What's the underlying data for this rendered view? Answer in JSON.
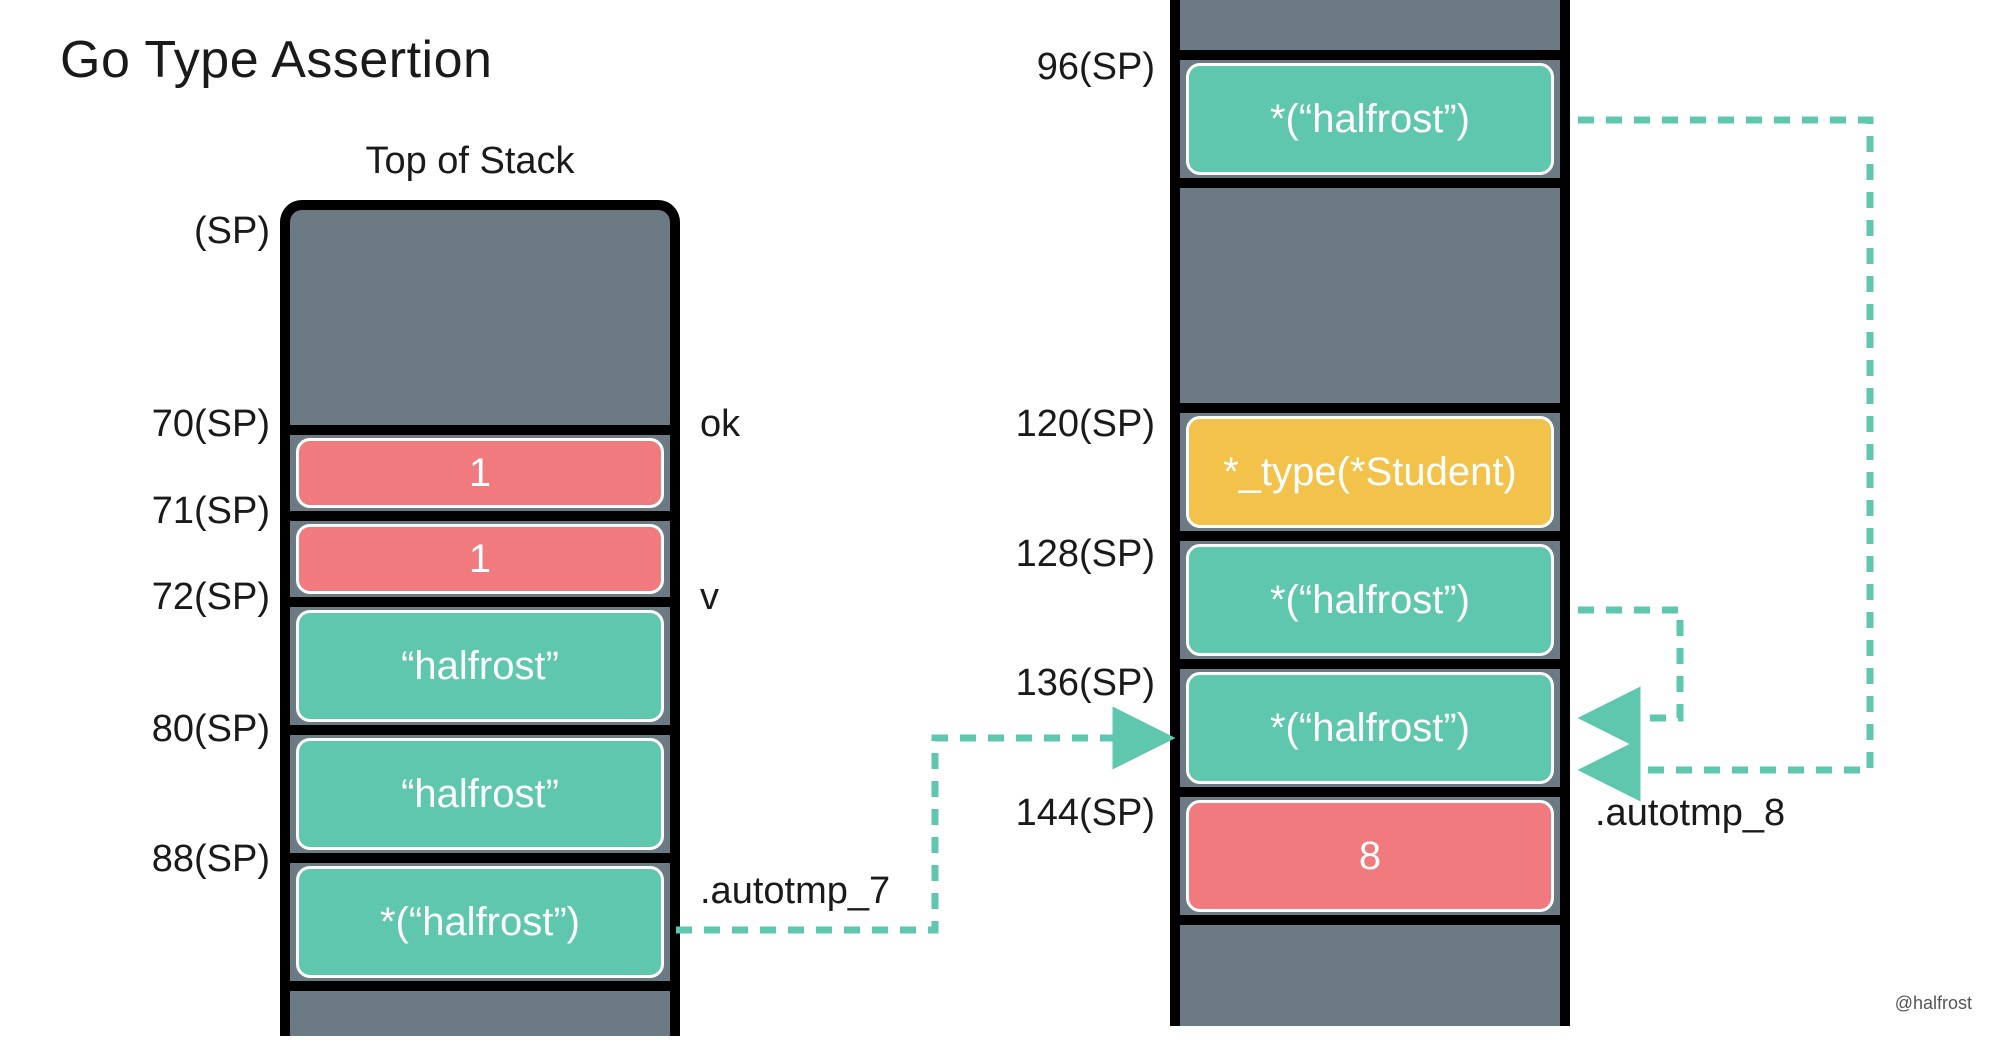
{
  "title": "Go Type Assertion",
  "subtitle": "Top of Stack",
  "credit": "@halfrost",
  "colors": {
    "pink": "#f07a7e",
    "teal": "#5ec7ae",
    "yellow": "#f3c24a",
    "gray": "#6c7a83",
    "dash": "#5ec7ae"
  },
  "left_stack": {
    "offsets": {
      "sp": "(SP)",
      "o70": "70(SP)",
      "o71": "71(SP)",
      "o72": "72(SP)",
      "o80": "80(SP)",
      "o88": "88(SP)"
    },
    "right_labels": {
      "ok": "ok",
      "v": "v",
      "autotmp7": ".autotmp_7"
    },
    "cells": {
      "c1": "1",
      "c2": "1",
      "c3": "“halfrost”",
      "c4": "“halfrost”",
      "c5": "*(“halfrost”)"
    }
  },
  "right_stack": {
    "offsets": {
      "o96": "96(SP)",
      "o120": "120(SP)",
      "o128": "128(SP)",
      "o136": "136(SP)",
      "o144": "144(SP)"
    },
    "right_labels": {
      "autotmp8": ".autotmp_8"
    },
    "cells": {
      "c1": "*(“halfrost”)",
      "c2": "*_type(*Student)",
      "c3": "*(“halfrost”)",
      "c4": "*(“halfrost”)",
      "c5": "8"
    }
  },
  "chart_data": {
    "type": "table",
    "title": "Go Type Assertion — stack layout",
    "stacks": [
      {
        "name": "left",
        "header": "Top of Stack",
        "rows": [
          {
            "offset": "(SP)",
            "value": null,
            "label": null,
            "color": "gray"
          },
          {
            "offset": "70(SP)",
            "value": "1",
            "label": "ok",
            "color": "pink"
          },
          {
            "offset": "71(SP)",
            "value": "1",
            "label": null,
            "color": "pink"
          },
          {
            "offset": "72(SP)",
            "value": "\"halfrost\"",
            "label": "v",
            "color": "teal"
          },
          {
            "offset": "80(SP)",
            "value": "\"halfrost\"",
            "label": null,
            "color": "teal"
          },
          {
            "offset": "88(SP)",
            "value": "*(\"halfrost\")",
            "label": ".autotmp_7",
            "color": "teal"
          }
        ]
      },
      {
        "name": "right",
        "rows": [
          {
            "offset": "96(SP)",
            "value": "*(\"halfrost\")",
            "label": null,
            "color": "teal"
          },
          {
            "offset": "120(SP)",
            "value": "*_type(*Student)",
            "label": null,
            "color": "yellow"
          },
          {
            "offset": "128(SP)",
            "value": "*(\"halfrost\")",
            "label": null,
            "color": "teal"
          },
          {
            "offset": "136(SP)",
            "value": "*(\"halfrost\")",
            "label": ".autotmp_8",
            "color": "teal"
          },
          {
            "offset": "144(SP)",
            "value": "8",
            "label": null,
            "color": "pink"
          }
        ]
      }
    ],
    "arrows": [
      {
        "from": "left:88(SP)",
        "to": "right:136(SP)",
        "style": "dashed"
      },
      {
        "from": "right:96(SP)",
        "to": "right:136(SP)",
        "style": "dashed"
      },
      {
        "from": "right:128(SP)",
        "to": "right:136(SP)",
        "style": "dashed"
      }
    ]
  }
}
